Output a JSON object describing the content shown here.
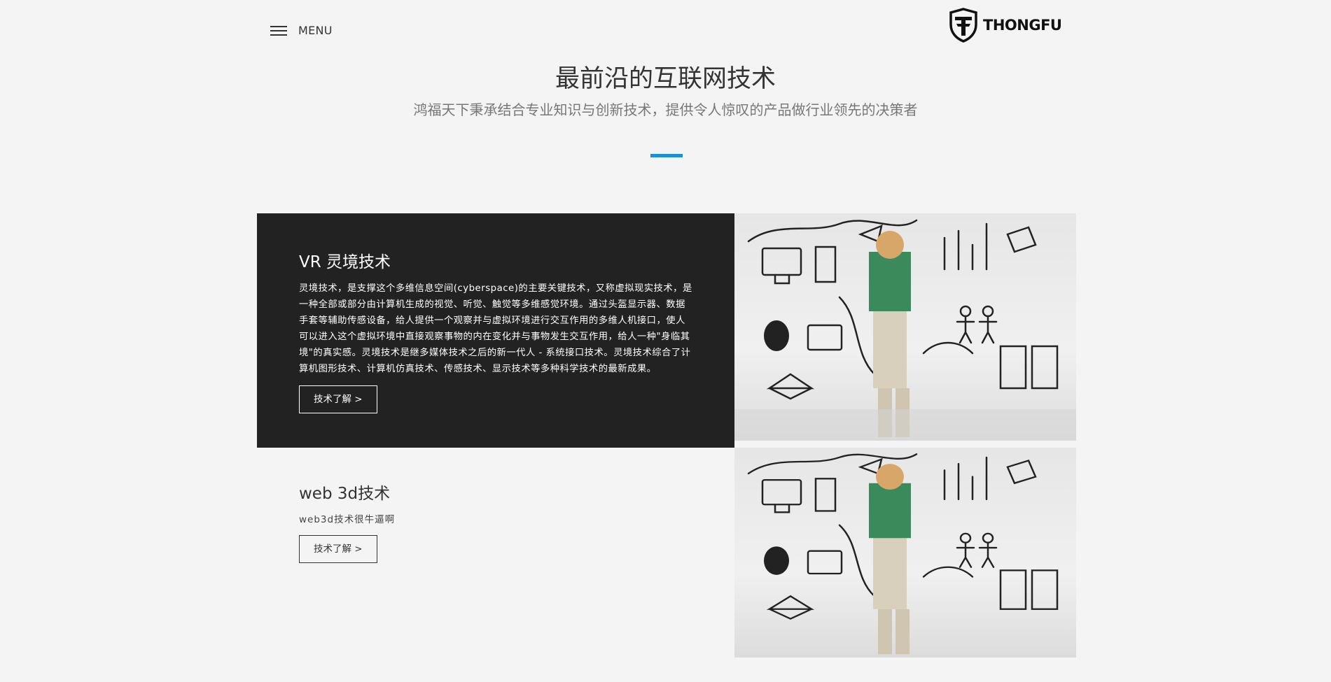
{
  "header": {
    "menu_label": "MENU",
    "logo_text": "THONGFU"
  },
  "hero": {
    "title": "最前沿的互联网技术",
    "subtitle": "鸿福天下秉承结合专业知识与创新技术，提供令人惊叹的产品做行业领先的决策者",
    "accent_color": "#1e8fd5"
  },
  "features": [
    {
      "title": "VR 灵境技术",
      "description": "灵境技术，是支撑这个多维信息空间(cyberspace)的主要关键技术，又称虚拟现实技术，是一种全部或部分由计算机生成的视觉、听觉、触觉等多维感觉环境。通过头盔显示器、数据手套等辅助传感设备，给人提供一个观察并与虚拟环境进行交互作用的多维人机接口，使人可以进入这个虚拟环境中直接观察事物的内在变化并与事物发生交互作用，给人一种\"身临其境\"的真实感。灵境技术是继多媒体技术之后的新一代人 - 系统接口技术。灵境技术综合了计算机图形技术、计算机仿真技术、传感技术、显示技术等多种科学技术的最新成果。",
      "button_label": "技术了解 >",
      "image_icon": "child-drawing-doodles-image"
    },
    {
      "title": "web 3d技术",
      "description": "web3d技术很牛逼啊",
      "button_label": "技术了解 >",
      "image_icon": "child-drawing-doodles-image"
    }
  ],
  "colors": {
    "background": "#f4f4f4",
    "dark_panel": "#222222"
  }
}
